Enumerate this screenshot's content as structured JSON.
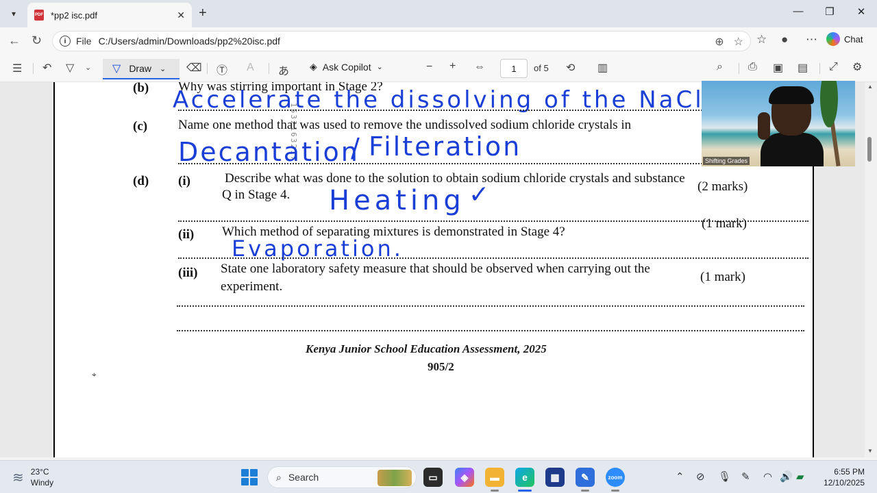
{
  "browser": {
    "tab_title": "*pp2 isc.pdf",
    "pdf_badge": "PDF",
    "address_prefix": "File",
    "url": "C:/Users/admin/Downloads/pp2%20isc.pdf",
    "chat_label": "Chat"
  },
  "pdf_toolbar": {
    "draw_label": "Draw",
    "ask_copilot_label": "Ask Copilot",
    "page_number": "1",
    "page_total": "of 5"
  },
  "document": {
    "q_b_label": "(b)",
    "q_b_text": "Why was stirring important in Stage 2?",
    "q_c_label": "(c)",
    "q_c_text": "Name one method that was used to remove the undissolved sodium chloride crystals in",
    "q_d_label": "(d)",
    "q_d_i_label": "(i)",
    "q_d_i_text_1": "Describe what was done to the solution to obtain sodium chloride crystals and substance",
    "q_d_i_text_2": "Q in Stage 4.",
    "q_d_i_marks": "(2 marks)",
    "q_d_ii_label": "(ii)",
    "q_d_ii_text": "Which method of separating mixtures is demonstrated in Stage 4?",
    "q_d_ii_marks": "(1 mark)",
    "q_d_iii_label": "(iii)",
    "q_d_iii_text_1": "State one laboratory safety measure that should be observed when carrying out the",
    "q_d_iii_text_2": "experiment.",
    "q_d_iii_marks": "(1 mark)",
    "footer_title": "Kenya Junior School Education Assessment, 2025",
    "footer_code": "905/2",
    "watermark": "1532163217"
  },
  "handwriting": {
    "answer_b": "Accelerate the dissolving of the NaCl.",
    "answer_c_1": "Decantation",
    "answer_c_2": "Filteration",
    "answer_d_i": "Heating",
    "answer_d_ii": "Evaporation."
  },
  "video": {
    "participant_name": "Shifting Grades"
  },
  "taskbar": {
    "temperature": "23°C",
    "weather": "Windy",
    "search_label": "Search",
    "time": "6:55 PM",
    "date": "12/10/2025"
  },
  "colors": {
    "ink": "#1a3fd6",
    "accent": "#2563eb"
  }
}
